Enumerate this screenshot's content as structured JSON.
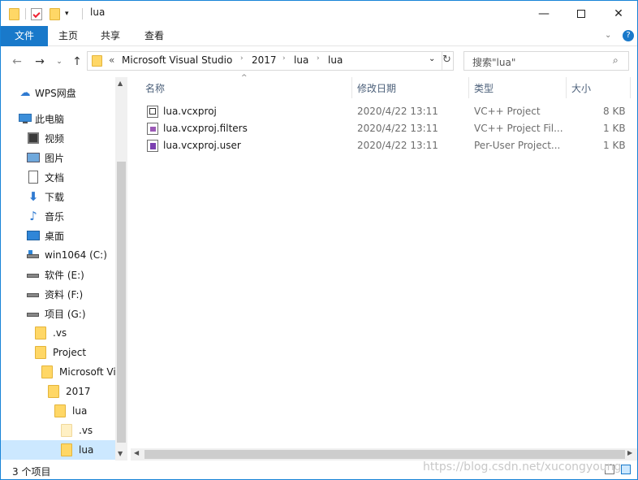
{
  "window": {
    "title": "lua"
  },
  "ribbon": {
    "tabs": [
      "文件",
      "主页",
      "共享",
      "查看"
    ]
  },
  "address": {
    "overflow": "«",
    "crumbs": [
      "Microsoft Visual Studio",
      "2017",
      "lua",
      "lua"
    ]
  },
  "search": {
    "placeholder": "搜索\"lua\""
  },
  "nav": {
    "quick_access": "WPS网盘",
    "this_pc": "此电脑",
    "items": [
      "视频",
      "图片",
      "文档",
      "下载",
      "音乐",
      "桌面",
      "win1064 (C:)",
      "软件 (E:)",
      "资料 (F:)",
      "项目 (G:)"
    ],
    "tree": [
      ".vs",
      "Project",
      "Microsoft Vi",
      "2017",
      "lua",
      ".vs",
      "lua"
    ]
  },
  "columns": {
    "name": "名称",
    "date": "修改日期",
    "type": "类型",
    "size": "大小"
  },
  "files": [
    {
      "name": "lua.vcxproj",
      "date": "2020/4/22 13:11",
      "type": "VC++ Project",
      "size": "8 KB"
    },
    {
      "name": "lua.vcxproj.filters",
      "date": "2020/4/22 13:11",
      "type": "VC++ Project Fil...",
      "size": "1 KB"
    },
    {
      "name": "lua.vcxproj.user",
      "date": "2020/4/22 13:11",
      "type": "Per-User Project...",
      "size": "1 KB"
    }
  ],
  "status": {
    "count": "3 个项目"
  },
  "watermark": "https://blog.csdn.net/xucongyoung",
  "colors": {
    "accent": "#1979ca",
    "folder": "#ffd766",
    "selection": "#cce8ff"
  }
}
